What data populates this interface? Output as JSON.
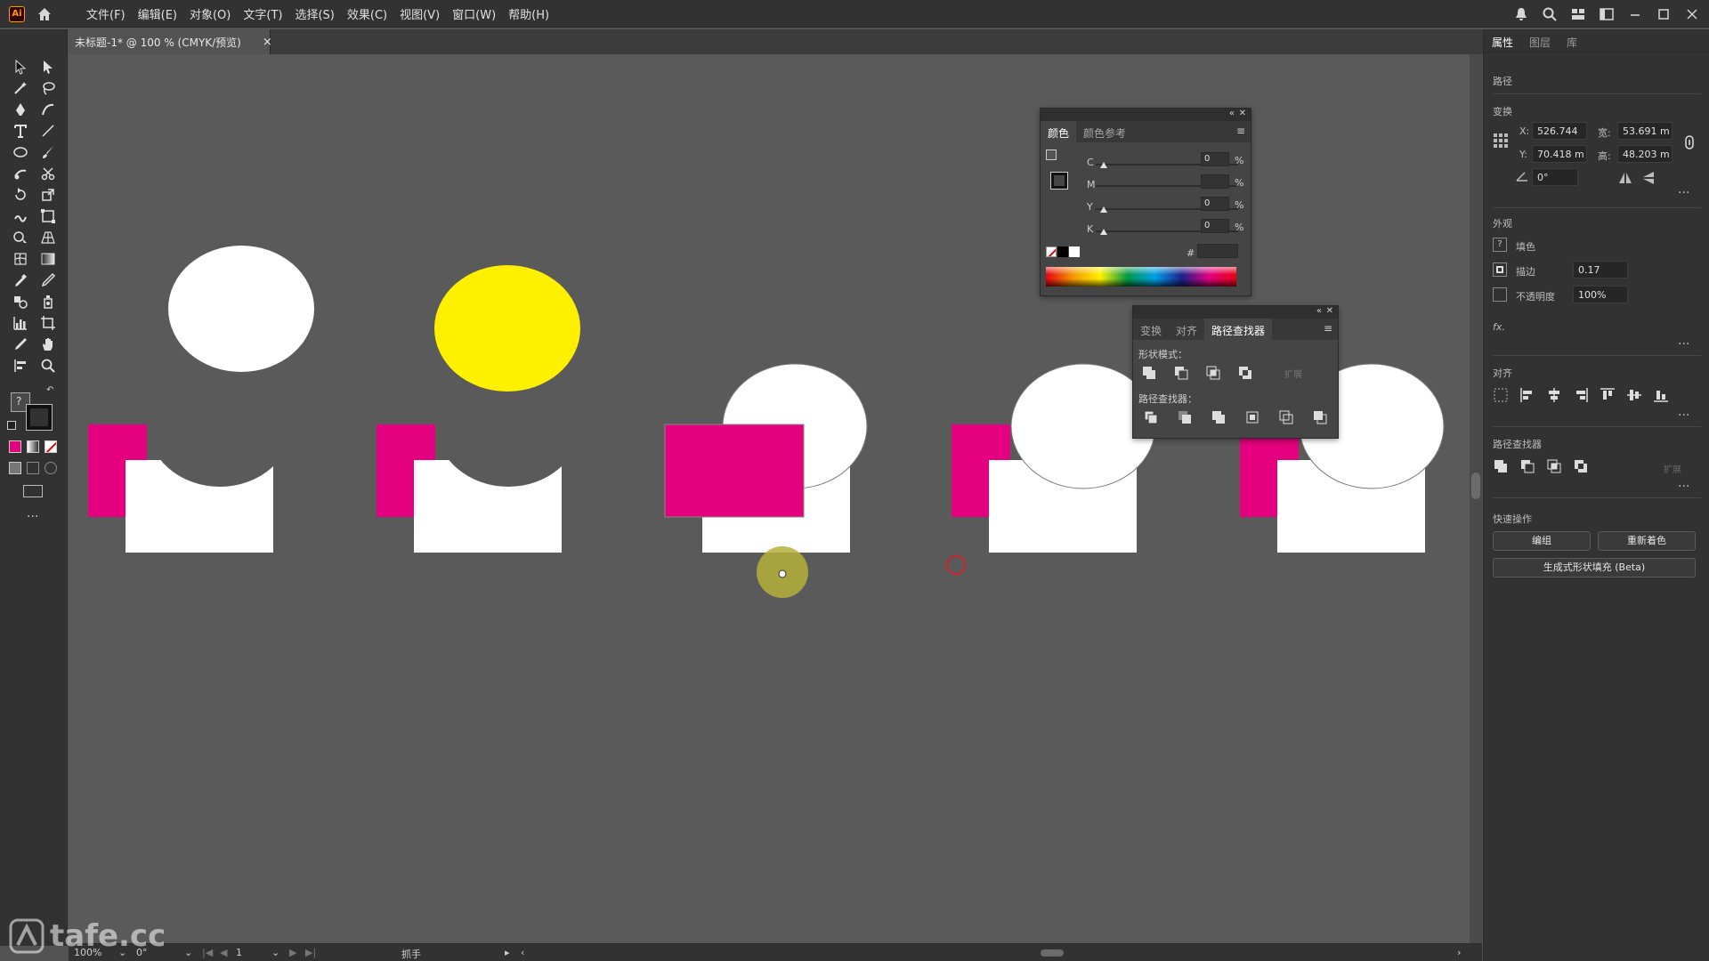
{
  "app": {
    "logo": "Ai",
    "menu": [
      "文件(F)",
      "编辑(E)",
      "对象(O)",
      "文字(T)",
      "选择(S)",
      "效果(C)",
      "视图(V)",
      "窗口(W)",
      "帮助(H)"
    ]
  },
  "document": {
    "tab_title": "未标题-1* @ 100 % (CMYK/预览)",
    "tab_close": "×"
  },
  "colors": {
    "magenta": "#e4007f",
    "yellow": "#fff000",
    "white": "#ffffff",
    "canvas": "#5a5a5a",
    "cursor_highlight": "#b5b03a",
    "red_marker": "#d0222a"
  },
  "color_panel": {
    "tabs": [
      "颜色",
      "颜色参考"
    ],
    "active_tab": "颜色",
    "channels": [
      {
        "label": "C",
        "value": "0",
        "unit": "%"
      },
      {
        "label": "M",
        "value": "",
        "unit": "%"
      },
      {
        "label": "Y",
        "value": "0",
        "unit": "%"
      },
      {
        "label": "K",
        "value": "0",
        "unit": "%"
      }
    ],
    "hex_label": "#",
    "hex_value": ""
  },
  "pathfinder_panel": {
    "tabs": [
      "变换",
      "对齐",
      "路径查找器"
    ],
    "active_tab": "路径查找器",
    "shape_modes_label": "形状模式：",
    "pathfinders_label": "路径查找器：",
    "expand_label": "扩展"
  },
  "properties": {
    "tabs": [
      "属性",
      "图层",
      "库"
    ],
    "active_tab": "属性",
    "object_type": "路径",
    "transform": {
      "title": "变换",
      "x_label": "X:",
      "x_value": "526.744",
      "y_label": "Y:",
      "y_value": "70.418 m",
      "w_label": "宽:",
      "w_value": "53.691 m",
      "h_label": "高:",
      "h_value": "48.203 m",
      "angle_value": "0°"
    },
    "appearance": {
      "title": "外观",
      "fill_label": "填色",
      "stroke_label": "描边",
      "stroke_value": "0.17",
      "opacity_label": "不透明度",
      "opacity_value": "100%",
      "fx_label": "fx."
    },
    "align": {
      "title": "对齐"
    },
    "pathfinder": {
      "title": "路径查找器",
      "expand_label": "扩展"
    },
    "quick_actions": {
      "title": "快速操作",
      "group_button": "编组",
      "recolor_button": "重新着色",
      "gen_fill_button": "生成式形状填充 (Beta)"
    }
  },
  "status": {
    "zoom": "100%",
    "rotation": "0°",
    "artboard": "1",
    "tool_name": "抓手"
  },
  "watermark": "tafe.cc"
}
